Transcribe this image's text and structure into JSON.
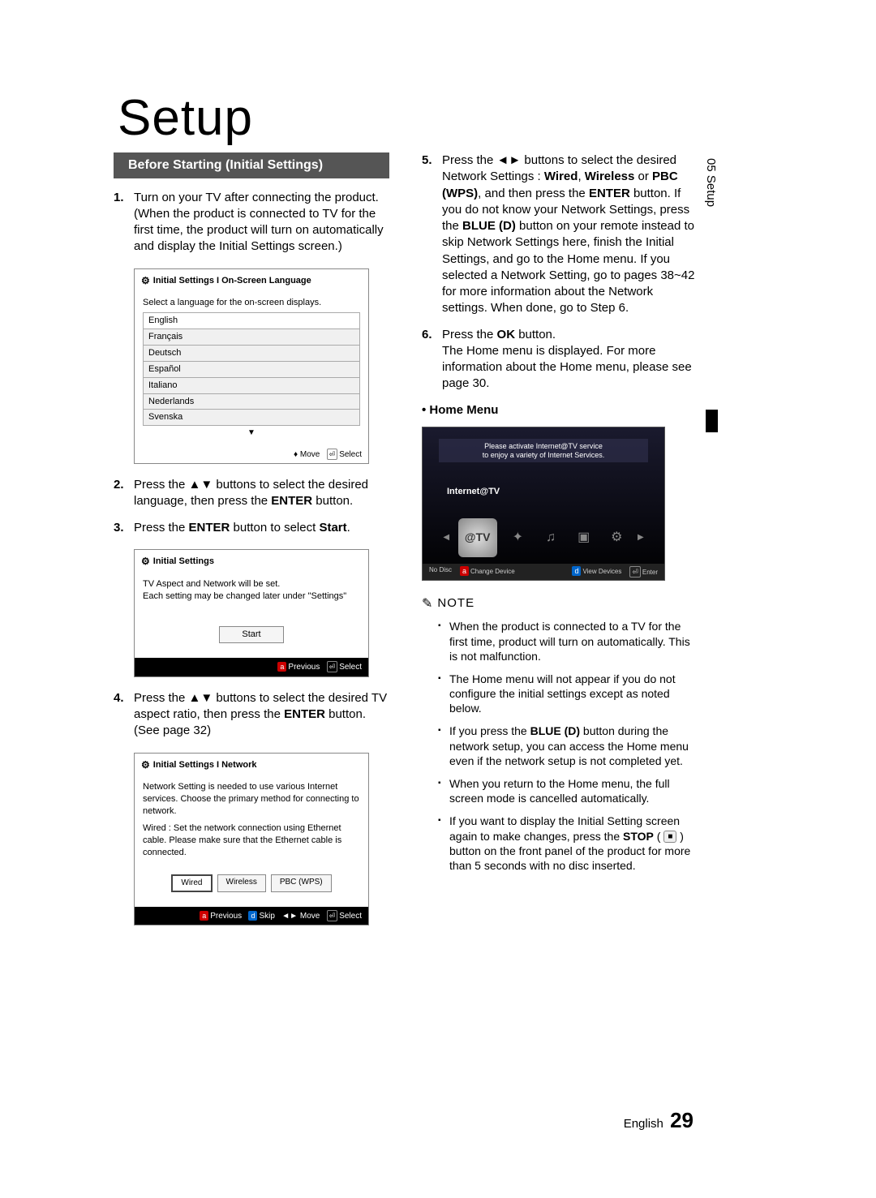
{
  "title": "Setup",
  "sideTab": "05   Setup",
  "sectionHeader": "Before Starting (Initial Settings)",
  "col1": {
    "step1": "Turn on your TV after connecting the product. (When the product is connected to TV for the first time, the product will turn on automatically and display the Initial Settings screen.)",
    "step2_a": "Press the ▲▼ buttons to select the desired language, then press the ",
    "step2_b": "ENTER",
    "step2_c": " button.",
    "step3_a": "Press the ",
    "step3_b": "ENTER",
    "step3_c": " button to select ",
    "step3_d": "Start",
    "step3_e": ".",
    "step4_a": "Press the ▲▼ buttons to select the desired TV aspect ratio, then press the ",
    "step4_b": "ENTER",
    "step4_c": " button. (See page 32)"
  },
  "ss1": {
    "title": "Initial Settings I On-Screen Language",
    "prompt": "Select a language for the on-screen displays.",
    "langs": [
      "English",
      "Français",
      "Deutsch",
      "Español",
      "Italiano",
      "Nederlands",
      "Svenska"
    ],
    "move": "Move",
    "select": "Select"
  },
  "ss2": {
    "title": "Initial Settings",
    "line1": "TV Aspect and Network will be set.",
    "line2": "Each setting may be changed later under \"Settings\"",
    "start": "Start",
    "prev": "Previous",
    "select": "Select"
  },
  "ss3": {
    "title": "Initial Settings I Network",
    "line1": "Network Setting is needed to use various Internet services. Choose the primary method for connecting to network.",
    "line2": "Wired : Set the network connection using Ethernet cable. Please make sure that the Ethernet cable is connected.",
    "btn1": "Wired",
    "btn2": "Wireless",
    "btn3": "PBC (WPS)",
    "prev": "Previous",
    "skip": "Skip",
    "move": "Move",
    "select": "Select"
  },
  "col2": {
    "step5_a": "Press the ◄► buttons to select the desired Network Settings : ",
    "step5_b": "Wired",
    "step5_c": ", ",
    "step5_d": "Wireless",
    "step5_e": " or ",
    "step5_f": "PBC (WPS)",
    "step5_g": ", and then press the ",
    "step5_h": "ENTER",
    "step5_i": " button. If you do not know your Network Settings, press the ",
    "step5_j": "BLUE (D)",
    "step5_k": " button on your remote instead to skip Network Settings here, finish the Initial Settings, and go to the Home menu. If you selected a Network Setting, go to pages 38~42 for more information about the Network settings. When done, go to Step 6.",
    "step6_a": "Press the ",
    "step6_b": "OK",
    "step6_c": " button.",
    "step6_d": "The Home menu is displayed. For more information about the Home menu, please see page 30.",
    "homeHead": "• Home Menu",
    "homeBanner": "Please activate Internet@TV service\nto enjoy a variety of Internet Services.",
    "homeLabel": "Internet@TV",
    "hf1": "No Disc",
    "hf2": "Change Device",
    "hf3": "View Devices",
    "hf4": "Enter",
    "noteHead": "NOTE",
    "note1": "When the product is connected to a TV for the first time, product will turn on automatically. This is not malfunction.",
    "note2": "The Home menu will not appear if you do not configure the initial settings except as noted below.",
    "note3_a": "If you press the ",
    "note3_b": "BLUE (D)",
    "note3_c": " button during the network setup, you can access the Home menu even if the network setup is not completed yet.",
    "note4": "When you return to the Home menu, the full screen mode is cancelled automatically.",
    "note5_a": "If you want to display the Initial Setting screen again to make changes, press the ",
    "note5_b": "STOP",
    "note5_c": " button on the front panel of the product for more than 5 seconds with no disc inserted."
  },
  "footerLang": "English",
  "pageNum": "29"
}
